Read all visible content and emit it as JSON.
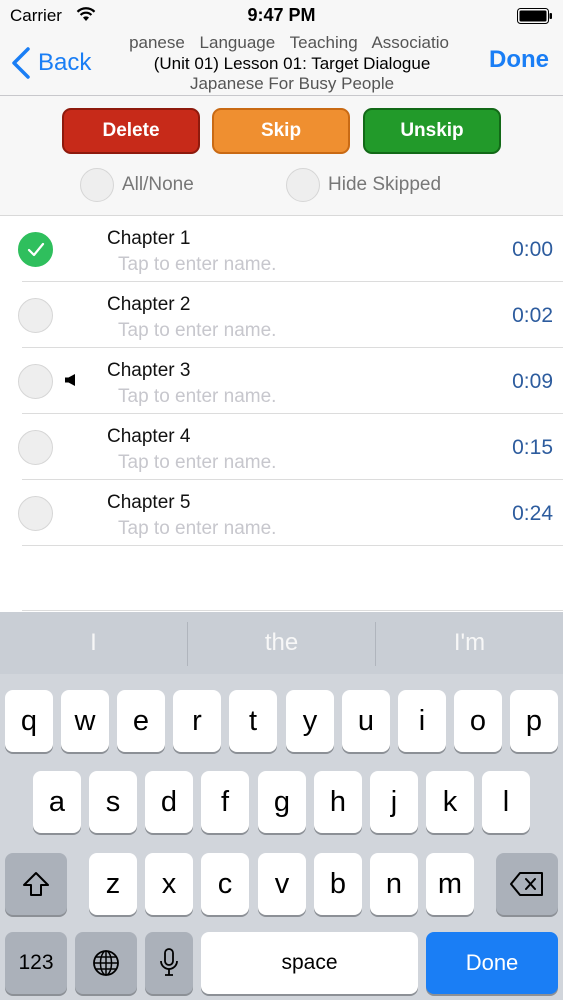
{
  "status": {
    "carrier": "Carrier",
    "time": "9:47 PM"
  },
  "nav": {
    "back": "Back",
    "done": "Done",
    "title_line1": "panese Language Teaching Associatio",
    "title_line2": "(Unit 01) Lesson 01: Target Dialogue",
    "title_line3": "Japanese For Busy People"
  },
  "actions": {
    "delete": "Delete",
    "skip": "Skip",
    "unskip": "Unskip",
    "all_none": "All/None",
    "hide_skipped": "Hide Skipped"
  },
  "chapters": [
    {
      "name": "Chapter 1",
      "placeholder": "Tap to enter name.",
      "time": "0:00",
      "checked": true
    },
    {
      "name": "Chapter 2",
      "placeholder": "Tap to enter name.",
      "time": "0:02",
      "checked": false
    },
    {
      "name": "Chapter 3",
      "placeholder": "Tap to enter name.",
      "time": "0:09",
      "checked": false,
      "playing": true
    },
    {
      "name": "Chapter 4",
      "placeholder": "Tap to enter name.",
      "time": "0:15",
      "checked": false
    },
    {
      "name": "Chapter 5",
      "placeholder": "Tap to enter name.",
      "time": "0:24",
      "checked": false
    }
  ],
  "keyboard": {
    "suggestions": [
      "I",
      "the",
      "I'm"
    ],
    "row1": [
      "q",
      "w",
      "e",
      "r",
      "t",
      "y",
      "u",
      "i",
      "o",
      "p"
    ],
    "row2": [
      "a",
      "s",
      "d",
      "f",
      "g",
      "h",
      "j",
      "k",
      "l"
    ],
    "row3": [
      "z",
      "x",
      "c",
      "v",
      "b",
      "n",
      "m"
    ],
    "numbers": "123",
    "space": "space",
    "done": "Done"
  },
  "colors": {
    "accent": "#1a7ef5",
    "delete": "#c72a19",
    "skip": "#ef8f30",
    "unskip": "#229a2a",
    "check": "#2fbf5d",
    "time": "#2d5c9e"
  }
}
